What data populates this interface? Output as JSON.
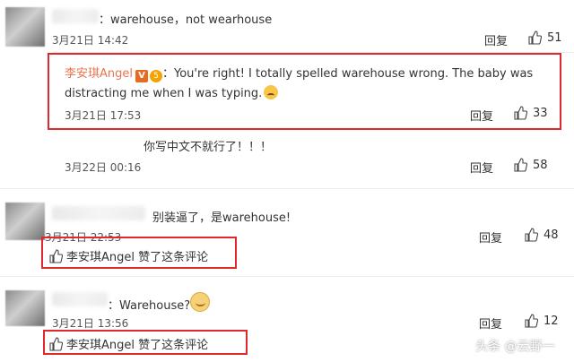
{
  "comments": [
    {
      "text": "：warehouse，not wearhouse",
      "time": "3月21日 14:42",
      "reply": "回复",
      "likes": "51"
    },
    {
      "author": "李安琪Angel",
      "text_line1": "：You're right! I totally spelled warehouse wrong. The baby was",
      "text_line2": "distracting me when I was typing.",
      "time": "3月21日 17:53",
      "reply": "回复",
      "likes": "33"
    },
    {
      "text": "你写中文不就行了！！！",
      "time": "3月22日 00:16",
      "reply": "回复",
      "likes": "58"
    },
    {
      "text": "别装逼了，是warehouse!",
      "time": "3月21日 22:53",
      "reply": "回复",
      "likes": "48",
      "liked_by": "李安琪Angel 赞了这条评论"
    },
    {
      "text": "：Warehouse?",
      "time": "3月21日 13:56",
      "reply": "回复",
      "likes": "12",
      "liked_by": "李安琪Angel 赞了这条评论"
    }
  ],
  "watermark": "头条 @云野一",
  "colors": {
    "highlight_border": "#e0292d",
    "author_name": "#eb7350"
  },
  "icons": [
    "thumbs-up-icon",
    "verified-badge-icon",
    "crying-emoji-icon",
    "grinning-emoji-icon"
  ]
}
